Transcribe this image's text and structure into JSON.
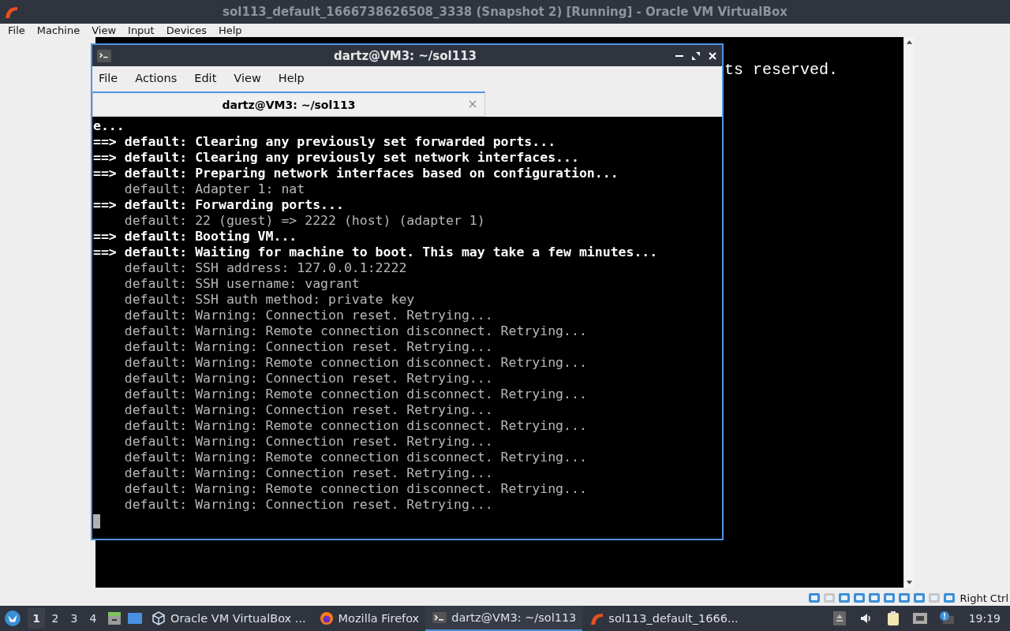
{
  "window": {
    "title": "sol113_default_1666738626508_3338 (Snapshot 2) [Running] - Oracle VM VirtualBox"
  },
  "menu": [
    "File",
    "Machine",
    "View",
    "Input",
    "Devices",
    "Help"
  ],
  "vm_screen": {
    "text": "ts reserved."
  },
  "terminal": {
    "title": "dartz@VM3: ~/sol113",
    "menu": [
      "File",
      "Actions",
      "Edit",
      "View",
      "Help"
    ],
    "tab": {
      "label": "dartz@VM3: ~/sol113"
    },
    "lines": [
      {
        "text": "e...",
        "bold": true
      },
      {
        "text": "==> default: Clearing any previously set forwarded ports...",
        "bold": true
      },
      {
        "text": "==> default: Clearing any previously set network interfaces...",
        "bold": true
      },
      {
        "text": "==> default: Preparing network interfaces based on configuration...",
        "bold": true
      },
      {
        "text": "    default: Adapter 1: nat",
        "bold": false
      },
      {
        "text": "==> default: Forwarding ports...",
        "bold": true
      },
      {
        "text": "    default: 22 (guest) => 2222 (host) (adapter 1)",
        "bold": false
      },
      {
        "text": "==> default: Booting VM...",
        "bold": true
      },
      {
        "text": "==> default: Waiting for machine to boot. This may take a few minutes...",
        "bold": true
      },
      {
        "text": "    default: SSH address: 127.0.0.1:2222",
        "bold": false
      },
      {
        "text": "    default: SSH username: vagrant",
        "bold": false
      },
      {
        "text": "    default: SSH auth method: private key",
        "bold": false
      },
      {
        "text": "    default: Warning: Connection reset. Retrying...",
        "bold": false
      },
      {
        "text": "    default: Warning: Remote connection disconnect. Retrying...",
        "bold": false
      },
      {
        "text": "    default: Warning: Connection reset. Retrying...",
        "bold": false
      },
      {
        "text": "    default: Warning: Remote connection disconnect. Retrying...",
        "bold": false
      },
      {
        "text": "    default: Warning: Connection reset. Retrying...",
        "bold": false
      },
      {
        "text": "    default: Warning: Remote connection disconnect. Retrying...",
        "bold": false
      },
      {
        "text": "    default: Warning: Connection reset. Retrying...",
        "bold": false
      },
      {
        "text": "    default: Warning: Remote connection disconnect. Retrying...",
        "bold": false
      },
      {
        "text": "    default: Warning: Connection reset. Retrying...",
        "bold": false
      },
      {
        "text": "    default: Warning: Remote connection disconnect. Retrying...",
        "bold": false
      },
      {
        "text": "    default: Warning: Connection reset. Retrying...",
        "bold": false
      },
      {
        "text": "    default: Warning: Remote connection disconnect. Retrying...",
        "bold": false
      },
      {
        "text": "    default: Warning: Connection reset. Retrying...",
        "bold": false
      }
    ]
  },
  "status_bar": {
    "host_key": "Right Ctrl"
  },
  "taskbar": {
    "workspaces": [
      {
        "label": "1",
        "selected": true
      },
      {
        "label": "2",
        "selected": false
      },
      {
        "label": "3",
        "selected": false
      },
      {
        "label": "4",
        "selected": false
      }
    ],
    "tasks": [
      {
        "kind": "virtualbox",
        "label": "Oracle VM VirtualBox ...",
        "selected": false
      },
      {
        "kind": "firefox",
        "label": "Mozilla Firefox",
        "selected": false
      },
      {
        "kind": "terminal",
        "label": "dartz@VM3: ~/sol113",
        "selected": true
      },
      {
        "kind": "vm",
        "label": "sol113_default_1666...",
        "selected": false
      }
    ],
    "clock": "19:19"
  }
}
